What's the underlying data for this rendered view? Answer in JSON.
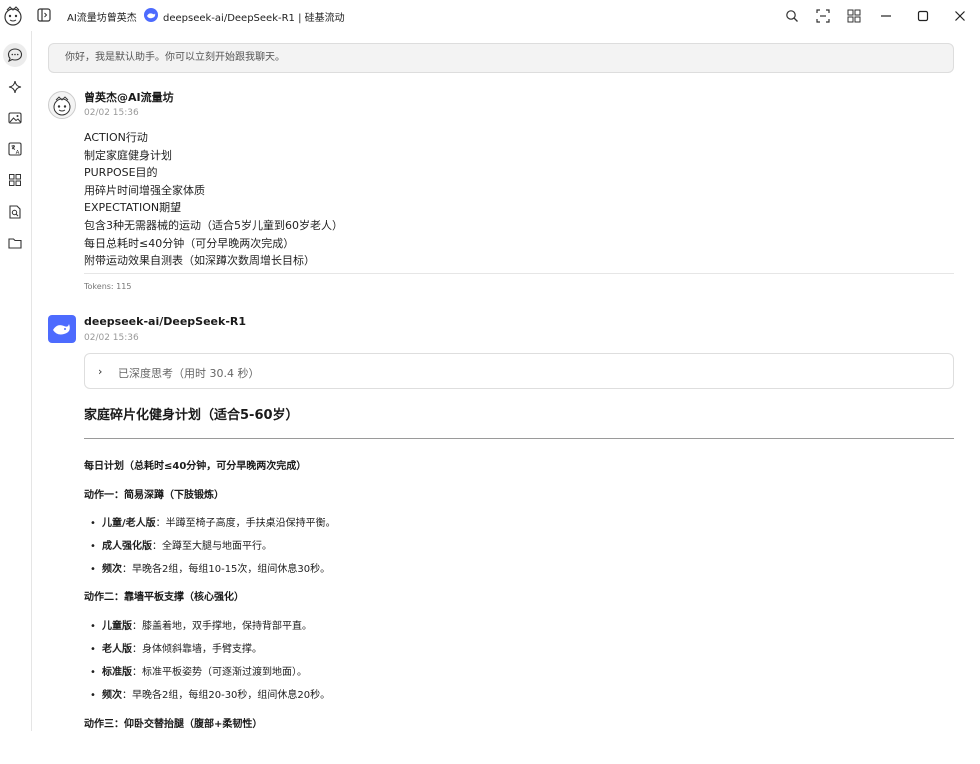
{
  "titlebar": {
    "assistant_name": "AI流量坊曾英杰",
    "model_name": "deepseek-ai/DeepSeek-R1 | 硅基流动"
  },
  "greeting": "你好，我是默认助手。你可以立刻开始跟我聊天。",
  "user_message": {
    "sender": "曾英杰@AI流量坊",
    "time": "02/02 15:36",
    "lines": [
      "ACTION行动",
      "制定家庭健身计划",
      "PURPOSE目的",
      "用碎片时间增强全家体质",
      "EXPECTATION期望",
      "包含3种无需器械的运动（适合5岁儿童到60岁老人）",
      "每日总耗时≤40分钟（可分早晚两次完成）",
      "附带运动效果自测表（如深蹲次数周增长目标）"
    ],
    "tokens": "Tokens: 115"
  },
  "assistant_message": {
    "sender": "deepseek-ai/DeepSeek-R1",
    "time": "02/02 15:36",
    "thinking_label": "已深度思考（用时 30.4 秒）",
    "title": "家庭碎片化健身计划（适合5-60岁）",
    "daily_plan": "每日计划（总耗时≤40分钟，可分早晚两次完成）",
    "action1": {
      "title": "动作一：简易深蹲（下肢锻炼）",
      "items": [
        {
          "label": "儿童/老人版",
          "text": "：半蹲至椅子高度，手扶桌沿保持平衡。"
        },
        {
          "label": "成人强化版",
          "text": "：全蹲至大腿与地面平行。"
        },
        {
          "label": "频次",
          "text": "：早晚各2组，每组10-15次，组间休息30秒。"
        }
      ]
    },
    "action2": {
      "title": "动作二：靠墙平板支撑（核心强化）",
      "items": [
        {
          "label": "儿童版",
          "text": "：膝盖着地，双手撑地，保持背部平直。"
        },
        {
          "label": "老人版",
          "text": "：身体倾斜靠墙，手臂支撑。"
        },
        {
          "label": "标准版",
          "text": "：标准平板姿势（可逐渐过渡到地面）。"
        },
        {
          "label": "频次",
          "text": "：早晚各2组，每组20-30秒，组间休息20秒。"
        }
      ]
    },
    "action3_title": "动作三：仰卧交替抬腿（腹部+柔韧性）"
  },
  "icons": {
    "titlebar": [
      "app-logo",
      "sidebar-toggle-icon",
      "deepseek-logo-icon",
      "search-icon",
      "fullscreen-icon",
      "grid-icon",
      "minimize-icon",
      "maximize-icon",
      "close-icon"
    ],
    "sidebar": [
      "chat-icon",
      "sparkle-icon",
      "image-icon",
      "translate-icon",
      "apps-icon",
      "file-search-icon",
      "folder-icon"
    ]
  },
  "colors": {
    "deepseek_blue": "#4d6bfe",
    "greeting_bg": "#f3f3f3",
    "muted_text": "#999999"
  }
}
